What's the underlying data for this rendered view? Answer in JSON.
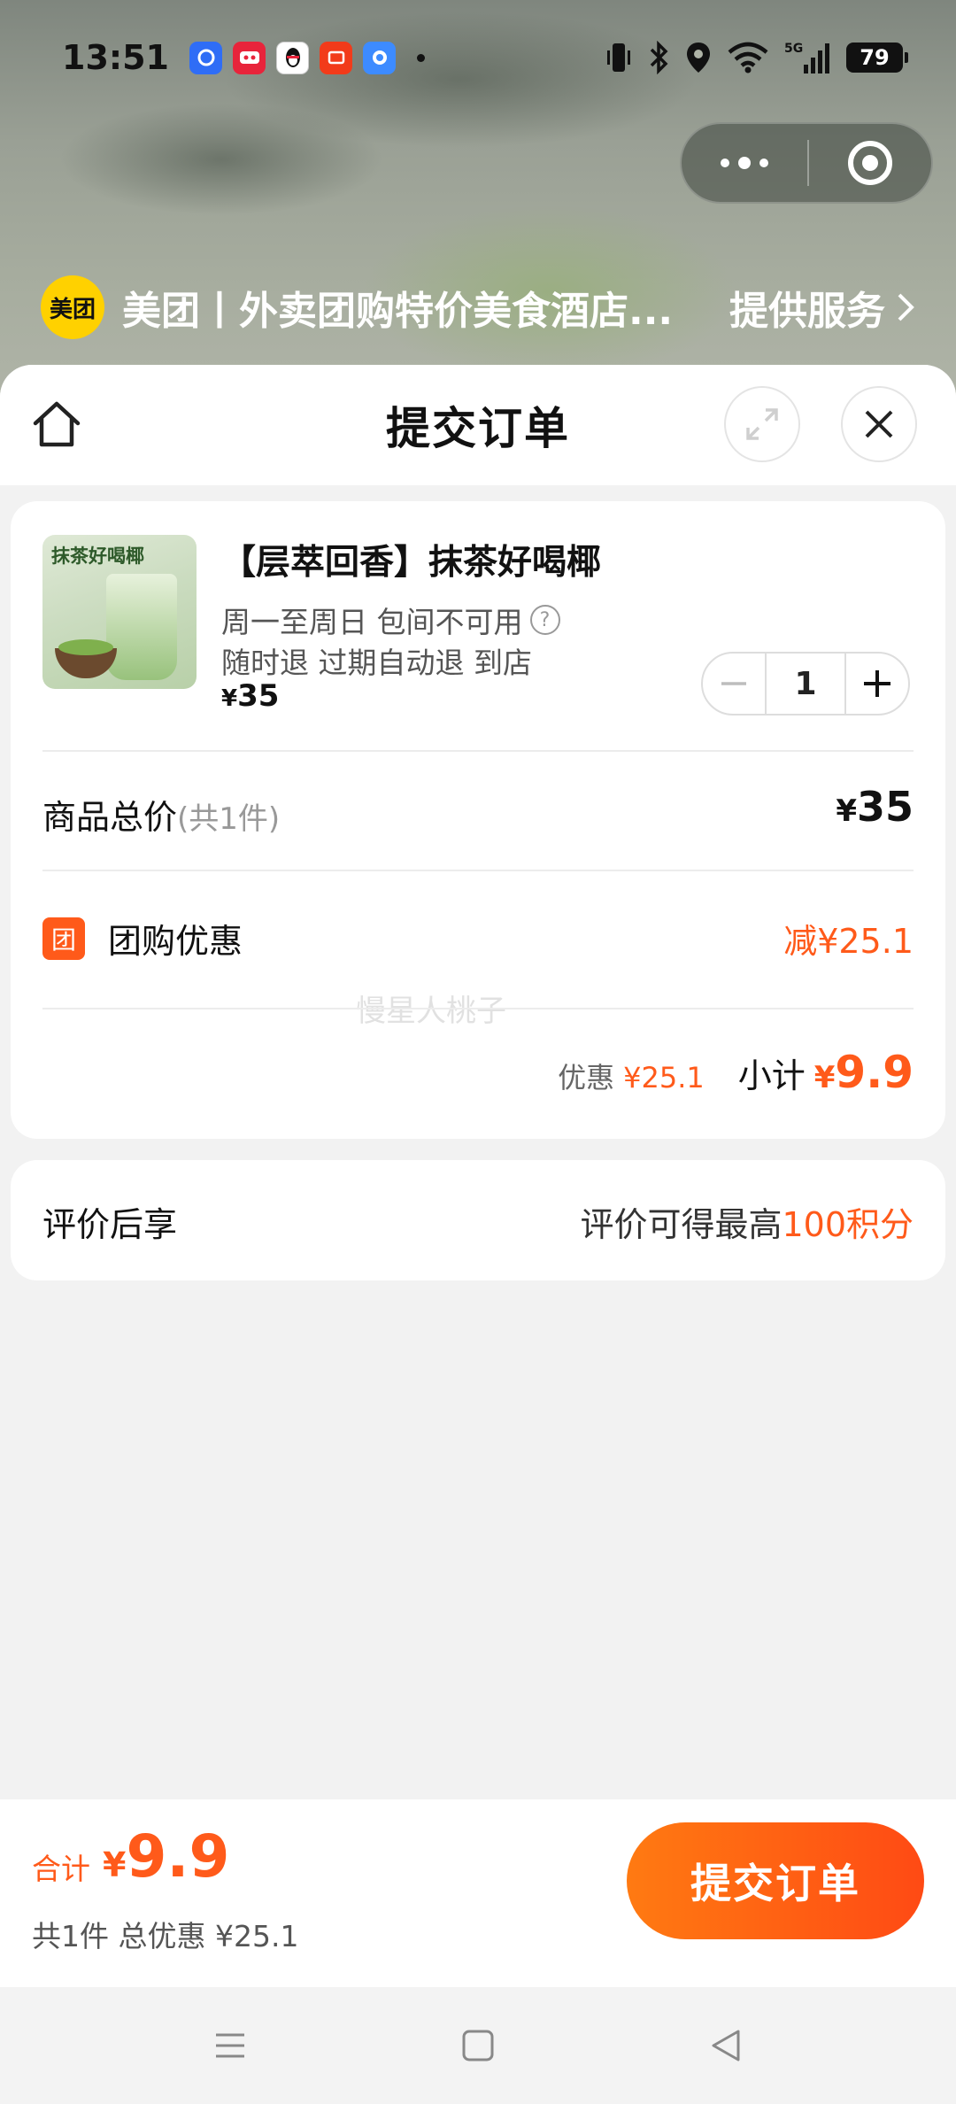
{
  "status_bar": {
    "time": "13:51",
    "notification_icons": [
      "safari-blue-icon",
      "tmall-icon",
      "qq-penguin-icon",
      "taobao-icon",
      "alipay-icon"
    ],
    "battery": "79",
    "network": "5G"
  },
  "provider": {
    "logo_text": "美团",
    "name": "美团丨外卖团购特价美食酒店...",
    "link_label": "提供服务"
  },
  "sheet": {
    "title": "提交订单"
  },
  "product": {
    "thumb_label": "抹茶好喝椰",
    "title": "【层萃回香】抹茶好喝椰",
    "usage": "周一至周日 包间不可用",
    "refund": "随时退 过期自动退 到店",
    "price_symbol": "¥",
    "price": "35",
    "quantity": "1"
  },
  "summary": {
    "total_label": "商品总价",
    "total_count": "(共1件)",
    "total_symbol": "¥",
    "total_value": "35",
    "group_badge": "团",
    "group_label": "团购优惠",
    "group_discount": "减¥25.1",
    "watermark": "慢星人桃子",
    "discount_label": "优惠",
    "discount_value": "¥25.1",
    "subtotal_label": "小计",
    "subtotal_symbol": "¥",
    "subtotal_value": "9.9"
  },
  "review": {
    "label": "评价后享",
    "text": "评价可得最高",
    "highlight": "100积分"
  },
  "bottom_bar": {
    "sum_label": "合计",
    "sum_symbol": "¥",
    "sum_value": "9.9",
    "sum_sub": "共1件 总优惠 ¥25.1",
    "submit_label": "提交订单"
  },
  "colors": {
    "accent": "#ff5a1a",
    "meituan_yellow": "#ffd100"
  }
}
